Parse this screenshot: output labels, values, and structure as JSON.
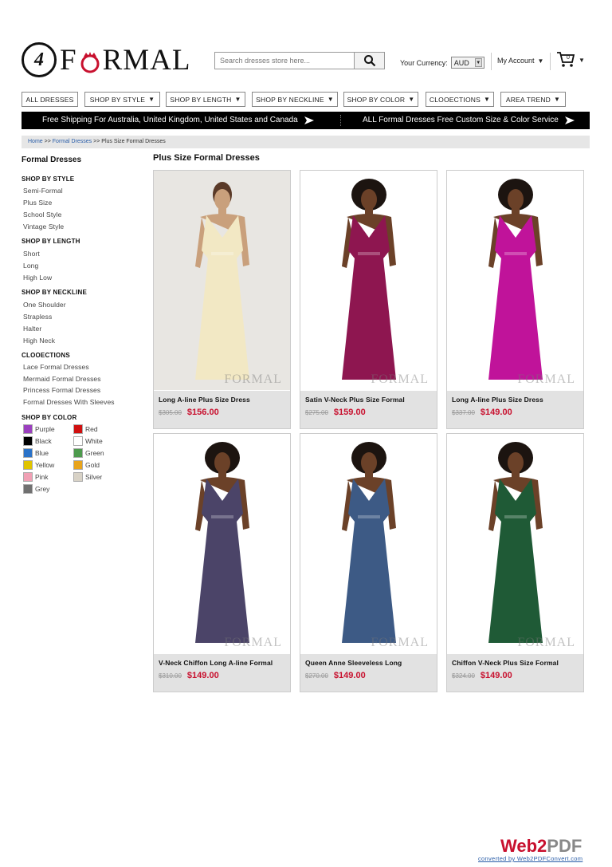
{
  "header": {
    "logo_glyph": "4",
    "logo_text_pre": "F",
    "logo_text_post": "RMAL",
    "search_placeholder": "Search dresses store here...",
    "currency_label": "Your Currency:",
    "currency_value": "AUD",
    "account_label": "My Account",
    "cart_count": "0"
  },
  "nav": [
    {
      "label": "ALL DRESSES"
    },
    {
      "label": "SHOP BY STYLE"
    },
    {
      "label": "SHOP BY LENGTH"
    },
    {
      "label": "SHOP BY NECKLINE"
    },
    {
      "label": "SHOP BY COLOR"
    },
    {
      "label": "CLOOECTIONS"
    },
    {
      "label": "AREA TREND"
    }
  ],
  "promo": {
    "left": "Free Shipping For Australia, United Kingdom, United States and Canada",
    "right": "ALL Formal Dresses Free Custom Size & Color Service"
  },
  "breadcrumb": {
    "home": "Home",
    "sep": ">>",
    "category": "Formal Dresses",
    "current": "Plus Size Formal Dresses"
  },
  "sidebar": {
    "title": "Formal Dresses",
    "style_heading": "SHOP BY STYLE",
    "style_items": [
      "Semi-Formal",
      "Plus Size",
      "School Style",
      "Vintage Style"
    ],
    "length_heading": "SHOP BY LENGTH",
    "length_items": [
      "Short",
      "Long",
      "High Low"
    ],
    "neckline_heading": "SHOP BY NECKLINE",
    "neckline_items": [
      "One Shoulder",
      "Strapless",
      "Halter",
      "High Neck"
    ],
    "collections_heading": "CLOOECTIONS",
    "collections_items": [
      "Lace Formal Dresses",
      "Mermaid Formal Dresses",
      "Princess Formal Dresses",
      "Formal Dresses With Sleeves"
    ],
    "color_heading": "SHOP BY COLOR",
    "colors": [
      {
        "name": "Purple",
        "hex": "#9b3fbf"
      },
      {
        "name": "Red",
        "hex": "#d01010"
      },
      {
        "name": "Black",
        "hex": "#000000"
      },
      {
        "name": "White",
        "hex": "#ffffff"
      },
      {
        "name": "Blue",
        "hex": "#2a72c8"
      },
      {
        "name": "Green",
        "hex": "#4d9a4d"
      },
      {
        "name": "Yellow",
        "hex": "#e0c400"
      },
      {
        "name": "Gold",
        "hex": "#e8a41c"
      },
      {
        "name": "Pink",
        "hex": "#f0a0b4"
      },
      {
        "name": "Silver",
        "hex": "#d8d2c6"
      },
      {
        "name": "Grey",
        "hex": "#707070"
      }
    ]
  },
  "main": {
    "title": "Plus Size Formal Dresses",
    "products": [
      {
        "name": "Long A-line Plus Size Dress",
        "old_price": "$305.00",
        "new_price": "$156.00",
        "dress_color": "#f2e8c4",
        "skin": "#c9a07c",
        "watermark": "FORMAL"
      },
      {
        "name": "Satin V-Neck Plus Size Formal",
        "old_price": "$275.00",
        "new_price": "$159.00",
        "dress_color": "#8e1650",
        "skin": "#6b4128",
        "watermark": "FORMAL"
      },
      {
        "name": "Long A-line Plus Size Dress",
        "old_price": "$337.00",
        "new_price": "$149.00",
        "dress_color": "#c0139a",
        "skin": "#6b4128",
        "watermark": "FORMAL"
      },
      {
        "name": "V-Neck Chiffon Long A-line Formal",
        "old_price": "$310.00",
        "new_price": "$149.00",
        "dress_color": "#4b4468",
        "skin": "#6b4128",
        "watermark": "FORMAL"
      },
      {
        "name": "Queen Anne Sleeveless Long",
        "old_price": "$270.00",
        "new_price": "$149.00",
        "dress_color": "#3d5a85",
        "skin": "#6b4128",
        "watermark": "FORMAL"
      },
      {
        "name": "Chiffon V-Neck Plus Size Formal",
        "old_price": "$324.00",
        "new_price": "$149.00",
        "dress_color": "#1f5a36",
        "skin": "#6b4128",
        "watermark": "FORMAL"
      }
    ]
  },
  "footer": {
    "badge_main": "Web2",
    "badge_pdf": "PDF",
    "badge_link": "converted by Web2PDFConvert.com"
  }
}
